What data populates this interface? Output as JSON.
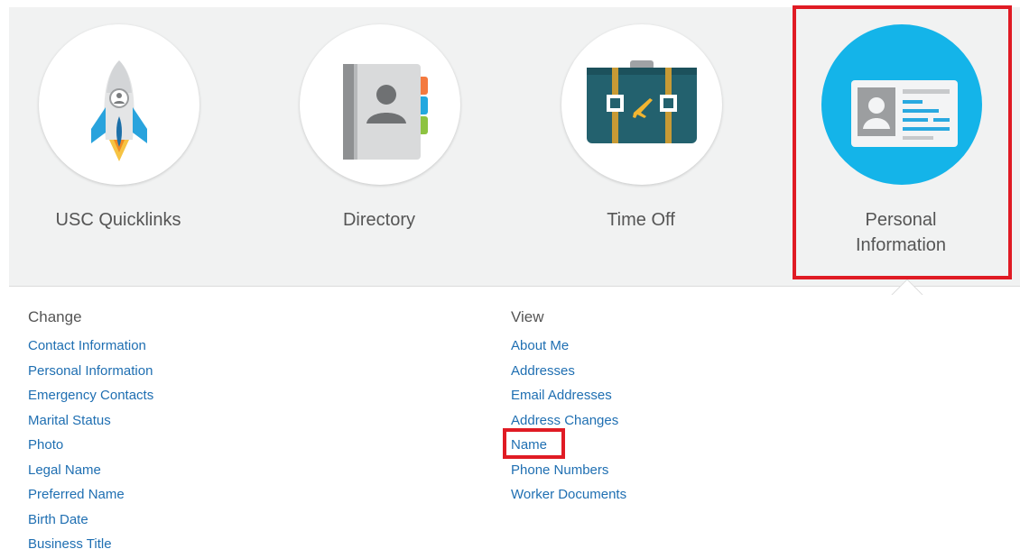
{
  "apps": [
    {
      "id": "quicklinks",
      "label": "USC Quicklinks",
      "icon": "rocket-icon"
    },
    {
      "id": "directory",
      "label": "Directory",
      "icon": "address-book-icon"
    },
    {
      "id": "timeoff",
      "label": "Time Off",
      "icon": "suitcase-icon"
    },
    {
      "id": "personal",
      "label": "Personal\nInformation",
      "icon": "id-card-icon",
      "selected": true
    }
  ],
  "colors": {
    "link": "#1f6fb2",
    "highlight": "#e01b24",
    "personal_circle": "#14b4e9",
    "bar_background": "#f1f2f2"
  },
  "change": {
    "title": "Change",
    "links": [
      "Contact Information",
      "Personal Information",
      "Emergency Contacts",
      "Marital Status",
      "Photo",
      "Legal Name",
      "Preferred Name",
      "Birth Date",
      "Business Title"
    ]
  },
  "view": {
    "title": "View",
    "links": [
      "About Me",
      "Addresses",
      "Email Addresses",
      "Address Changes",
      "Name",
      "Phone Numbers",
      "Worker Documents"
    ]
  }
}
